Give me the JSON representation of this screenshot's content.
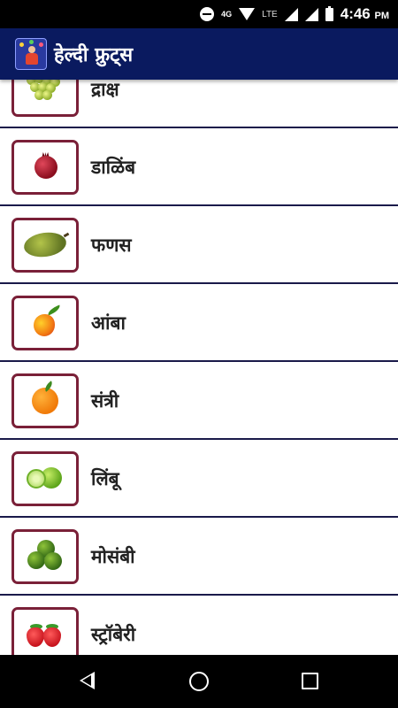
{
  "status_bar": {
    "time": "4:46",
    "ampm": "PM",
    "network_type": "4G",
    "lte_label": "LTE",
    "icons": [
      "do-not-disturb-icon",
      "wifi-icon",
      "signal-icon",
      "battery-icon"
    ]
  },
  "app_bar": {
    "title": "हेल्दी फ्रुट्स",
    "logo_icon": "juggler-logo-icon",
    "color": "#0a1a5f"
  },
  "fruits": [
    {
      "label": "द्राक्ष",
      "icon": "grapes-icon"
    },
    {
      "label": "डाळिंब",
      "icon": "pomegranate-icon"
    },
    {
      "label": "फणस",
      "icon": "jackfruit-icon"
    },
    {
      "label": "आंबा",
      "icon": "mango-icon"
    },
    {
      "label": "संत्री",
      "icon": "orange-icon"
    },
    {
      "label": "लिंबू",
      "icon": "lemon-icon"
    },
    {
      "label": "मोसंबी",
      "icon": "sweet-lime-icon"
    },
    {
      "label": "स्ट्रॉबेरी",
      "icon": "strawberry-icon"
    }
  ],
  "colors": {
    "thumb_border": "#7a2038",
    "divider": "#1a1a4a"
  },
  "nav_bar": {
    "buttons": [
      "back-icon",
      "home-icon",
      "recent-apps-icon"
    ]
  }
}
